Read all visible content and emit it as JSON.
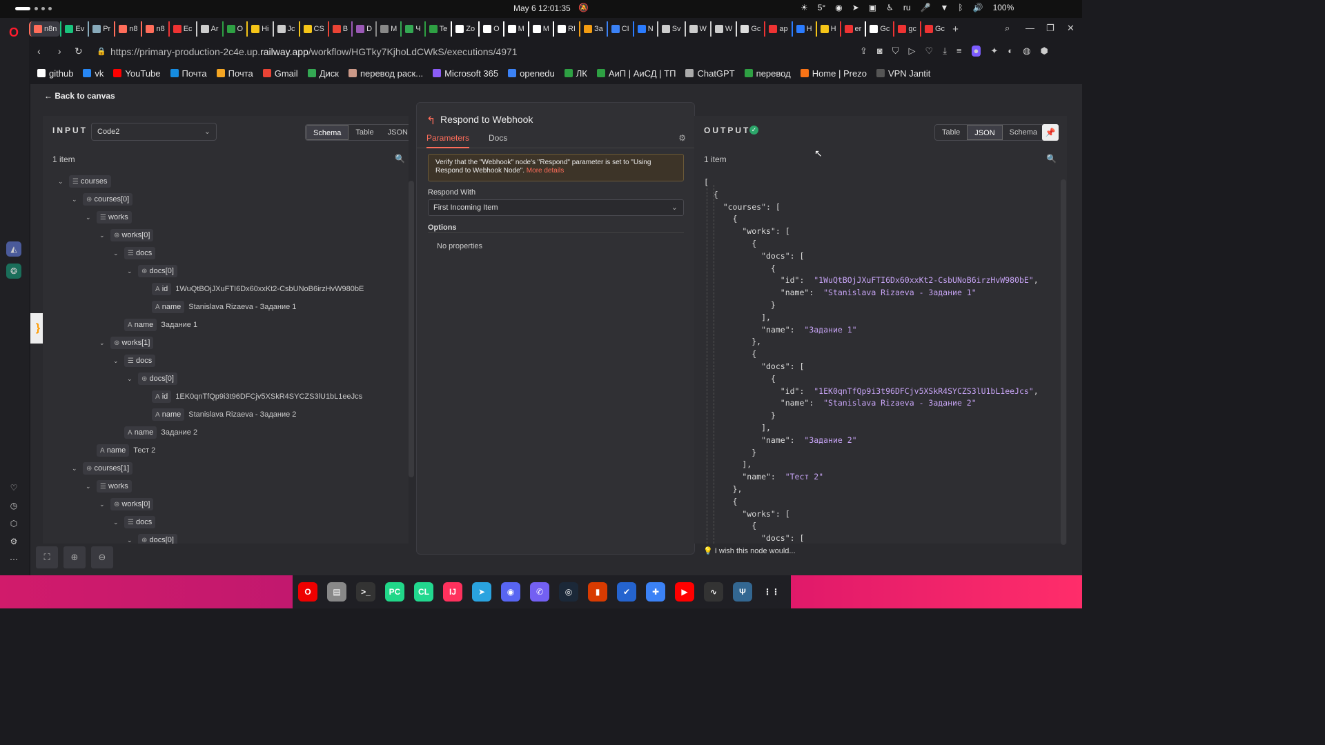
{
  "system": {
    "datetime": "May 6  12:01:35",
    "status": {
      "temp": "5°",
      "lang": "ru",
      "battery": "100%"
    }
  },
  "tabs": [
    {
      "label": "n8n",
      "color": "#ff6d5a",
      "active": true
    },
    {
      "label": "Ev",
      "color": "#19c37d"
    },
    {
      "label": "Pr",
      "color": "#8ab"
    },
    {
      "label": "n8",
      "color": "#ff6d5a"
    },
    {
      "label": "n8",
      "color": "#ff6d5a"
    },
    {
      "label": "Ec",
      "color": "#e33"
    },
    {
      "label": "Ar",
      "color": "#ccc"
    },
    {
      "label": "O",
      "color": "#2ea043"
    },
    {
      "label": "Hi",
      "color": "#f5c518"
    },
    {
      "label": "Jc",
      "color": "#ccc"
    },
    {
      "label": "CS",
      "color": "#f5c518"
    },
    {
      "label": "B",
      "color": "#ea4335"
    },
    {
      "label": "D",
      "color": "#9b59b6"
    },
    {
      "label": "M",
      "color": "#888"
    },
    {
      "label": "Ч",
      "color": "#34a853"
    },
    {
      "label": "Te",
      "color": "#2ea043"
    },
    {
      "label": "Zo",
      "color": "#fff"
    },
    {
      "label": "O",
      "color": "#fff"
    },
    {
      "label": "M",
      "color": "#fff"
    },
    {
      "label": "M",
      "color": "#fff"
    },
    {
      "label": "RI",
      "color": "#fff"
    },
    {
      "label": "За",
      "color": "#f39c12"
    },
    {
      "label": "CI",
      "color": "#3b82f6"
    },
    {
      "label": "N",
      "color": "#2b7cff"
    },
    {
      "label": "Sv",
      "color": "#ccc"
    },
    {
      "label": "W",
      "color": "#ccc"
    },
    {
      "label": "W",
      "color": "#ccc"
    },
    {
      "label": "Gc",
      "color": "#ddd"
    },
    {
      "label": "ap",
      "color": "#e33"
    },
    {
      "label": "H",
      "color": "#2b7cff"
    },
    {
      "label": "H",
      "color": "#f5c518"
    },
    {
      "label": "er",
      "color": "#e33"
    },
    {
      "label": "Gc",
      "color": "#fff"
    },
    {
      "label": "gc",
      "color": "#e33"
    },
    {
      "label": "Gc",
      "color": "#e33"
    }
  ],
  "url": {
    "prefix": "https://primary-production-2c4e.up.",
    "domain": "railway.app",
    "path": "/workflow/HGTky7KjhoLdCWkS/executions/4971"
  },
  "bookmarks": [
    {
      "label": "github",
      "color": "#fff"
    },
    {
      "label": "vk",
      "color": "#2787f5"
    },
    {
      "label": "YouTube",
      "color": "#ff0000"
    },
    {
      "label": "Почта",
      "color": "#168de2"
    },
    {
      "label": "Почта",
      "color": "#f5a623"
    },
    {
      "label": "Gmail",
      "color": "#ea4335"
    },
    {
      "label": "Диск",
      "color": "#34a853"
    },
    {
      "label": "перевод раск...",
      "color": "#c98"
    },
    {
      "label": "Microsoft 365",
      "color": "#8b5cf6"
    },
    {
      "label": "openedu",
      "color": "#3b82f6"
    },
    {
      "label": "ЛК",
      "color": "#2ea043"
    },
    {
      "label": "АиП | АиСД | ТП",
      "color": "#2ea043"
    },
    {
      "label": "ChatGPT",
      "color": "#aaa"
    },
    {
      "label": "перевод",
      "color": "#2ea043"
    },
    {
      "label": "Home | Prezo",
      "color": "#f97316"
    },
    {
      "label": "VPN Jantit",
      "color": "#555"
    }
  ],
  "n8n": {
    "back": "Back to canvas",
    "input": {
      "heading": "INPUT",
      "node": "Code2",
      "views": [
        "Schema",
        "Table",
        "JSON"
      ],
      "count": "1 item",
      "tree": [
        {
          "depth": 0,
          "arrow": "⌄",
          "icon": "☰",
          "key": "courses",
          "val": ""
        },
        {
          "depth": 1,
          "arrow": "⌄",
          "icon": "⊛",
          "key": "courses[0]",
          "val": ""
        },
        {
          "depth": 2,
          "arrow": "⌄",
          "icon": "☰",
          "key": "works",
          "val": ""
        },
        {
          "depth": 3,
          "arrow": "⌄",
          "icon": "⊛",
          "key": "works[0]",
          "val": ""
        },
        {
          "depth": 4,
          "arrow": "⌄",
          "icon": "☰",
          "key": "docs",
          "val": ""
        },
        {
          "depth": 5,
          "arrow": "⌄",
          "icon": "⊛",
          "key": "docs[0]",
          "val": ""
        },
        {
          "depth": 6,
          "arrow": "",
          "icon": "A",
          "key": "id",
          "val": "1WuQtBOjJXuFTI6Dx60xxKt2-CsbUNoB6irzHvW980bE"
        },
        {
          "depth": 6,
          "arrow": "",
          "icon": "A",
          "key": "name",
          "val": "Stanislava Rizaeva - Задание 1"
        },
        {
          "depth": 4,
          "arrow": "",
          "icon": "A",
          "key": "name",
          "val": "Задание 1"
        },
        {
          "depth": 3,
          "arrow": "⌄",
          "icon": "⊛",
          "key": "works[1]",
          "val": ""
        },
        {
          "depth": 4,
          "arrow": "⌄",
          "icon": "☰",
          "key": "docs",
          "val": ""
        },
        {
          "depth": 5,
          "arrow": "⌄",
          "icon": "⊛",
          "key": "docs[0]",
          "val": ""
        },
        {
          "depth": 6,
          "arrow": "",
          "icon": "A",
          "key": "id",
          "val": "1EK0qnTfQp9i3t96DFCjv5XSkR4SYCZS3lU1bL1eeJcs"
        },
        {
          "depth": 6,
          "arrow": "",
          "icon": "A",
          "key": "name",
          "val": "Stanislava Rizaeva - Задание 2"
        },
        {
          "depth": 4,
          "arrow": "",
          "icon": "A",
          "key": "name",
          "val": "Задание 2"
        },
        {
          "depth": 2,
          "arrow": "",
          "icon": "A",
          "key": "name",
          "val": "Тест 2"
        },
        {
          "depth": 1,
          "arrow": "⌄",
          "icon": "⊛",
          "key": "courses[1]",
          "val": ""
        },
        {
          "depth": 2,
          "arrow": "⌄",
          "icon": "☰",
          "key": "works",
          "val": ""
        },
        {
          "depth": 3,
          "arrow": "⌄",
          "icon": "⊛",
          "key": "works[0]",
          "val": ""
        },
        {
          "depth": 4,
          "arrow": "⌄",
          "icon": "☰",
          "key": "docs",
          "val": ""
        },
        {
          "depth": 5,
          "arrow": "⌄",
          "icon": "⊛",
          "key": "docs[0]",
          "val": ""
        }
      ]
    },
    "node": {
      "title": "Respond to Webhook",
      "tab_params": "Parameters",
      "tab_docs": "Docs",
      "notice": "Verify that the \"Webhook\" node's \"Respond\" parameter is set to \"Using Respond to Webhook Node\". ",
      "notice_link": "More details",
      "respond_label": "Respond With",
      "respond_value": "First Incoming Item",
      "options_label": "Options",
      "no_props": "No properties",
      "wish": "I wish this node would..."
    },
    "output": {
      "heading": "OUTPUT",
      "views": [
        "Table",
        "JSON",
        "Schema"
      ],
      "count": "1 item",
      "json_lines": [
        "[",
        "  {",
        "    \"courses\": [",
        "      {",
        "        \"works\": [",
        "          {",
        "            \"docs\": [",
        "              {",
        "                \"id\":  \"1WuQtBOjJXuFTI6Dx60xxKt2-CsbUNoB6irzHvW980bE\",",
        "                \"name\":  \"Stanislava Rizaeva - Задание 1\"",
        "              }",
        "            ],",
        "            \"name\":  \"Задание 1\"",
        "          },",
        "          {",
        "            \"docs\": [",
        "              {",
        "                \"id\":  \"1EK0qnTfQp9i3t96DFCjv5XSkR4SYCZS3lU1bL1eeJcs\",",
        "                \"name\":  \"Stanislava Rizaeva - Задание 2\"",
        "              }",
        "            ],",
        "            \"name\":  \"Задание 2\"",
        "          }",
        "        ],",
        "        \"name\":  \"Тест 2\"",
        "      },",
        "      {",
        "        \"works\": [",
        "          {",
        "            \"docs\": ["
      ]
    }
  },
  "dock": [
    {
      "name": "opera-icon",
      "color": "#e00",
      "glyph": "O"
    },
    {
      "name": "files-icon",
      "color": "#888",
      "glyph": "▤"
    },
    {
      "name": "terminal-icon",
      "color": "#333",
      "glyph": ">_"
    },
    {
      "name": "pycharm-icon",
      "color": "#21d789",
      "glyph": "PC"
    },
    {
      "name": "clion-icon",
      "color": "#22d88f",
      "glyph": "CL"
    },
    {
      "name": "intellij-icon",
      "color": "#fe315d",
      "glyph": "IJ"
    },
    {
      "name": "telegram-icon",
      "color": "#2aa3df",
      "glyph": "➤"
    },
    {
      "name": "discord-icon",
      "color": "#5865f2",
      "glyph": "◉"
    },
    {
      "name": "viber-icon",
      "color": "#7360f2",
      "glyph": "✆"
    },
    {
      "name": "steam-icon",
      "color": "#1b2838",
      "glyph": "◎"
    },
    {
      "name": "office-icon",
      "color": "#d83b01",
      "glyph": "▮"
    },
    {
      "name": "todo-icon",
      "color": "#2564cf",
      "glyph": "✔"
    },
    {
      "name": "extensions-icon",
      "color": "#3b82f6",
      "glyph": "✚"
    },
    {
      "name": "youtube-music-icon",
      "color": "#f00",
      "glyph": "▶"
    },
    {
      "name": "monitor-icon",
      "color": "#333",
      "glyph": "∿"
    },
    {
      "name": "postgres-icon",
      "color": "#336791",
      "glyph": "Ψ"
    },
    {
      "name": "apps-grid-icon",
      "color": "#1f1f24",
      "glyph": "⋮⋮"
    }
  ]
}
